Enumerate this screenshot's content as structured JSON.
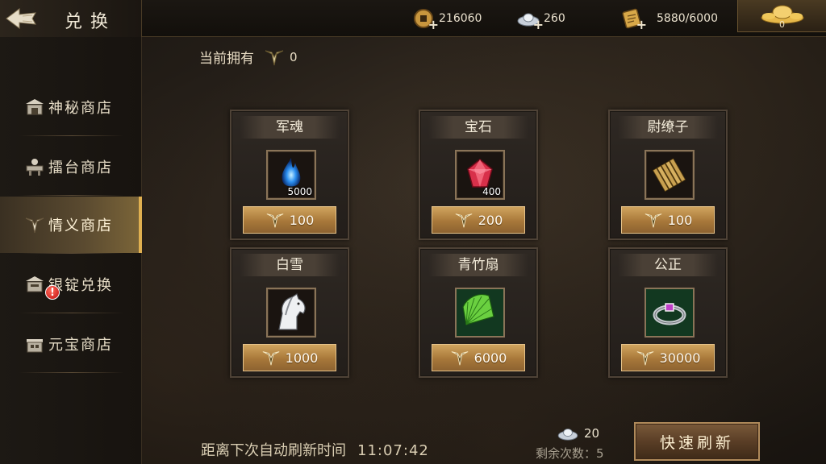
{
  "header": {
    "title": "兑换",
    "resources": [
      {
        "icon": "copper-coin-icon",
        "value": "216060"
      },
      {
        "icon": "silver-ingot-icon",
        "value": "260"
      },
      {
        "icon": "scroll-token-icon",
        "value": "5880/6000"
      }
    ],
    "gold": {
      "icon": "gold-ingot-icon",
      "value": "0"
    }
  },
  "sidebar": {
    "items": [
      {
        "label": "神秘商店",
        "icon": "mystery-shop-icon"
      },
      {
        "label": "擂台商店",
        "icon": "arena-shop-icon"
      },
      {
        "label": "情义商店",
        "icon": "loyalty-shop-icon",
        "active": true
      },
      {
        "label": "银锭兑换",
        "icon": "silver-exchange-icon"
      },
      {
        "label": "元宝商店",
        "icon": "ingot-shop-icon",
        "alert": "!"
      }
    ]
  },
  "owned": {
    "label": "当前拥有",
    "value": "0"
  },
  "items": [
    {
      "name": "军魂",
      "icon": "blue-flame-icon",
      "qty": "5000",
      "price": "100"
    },
    {
      "name": "宝石",
      "icon": "red-gem-icon",
      "qty": "400",
      "price": "200"
    },
    {
      "name": "尉缭子",
      "icon": "bamboo-scroll-icon",
      "qty": "",
      "price": "100"
    },
    {
      "name": "白雪",
      "icon": "white-horse-icon",
      "qty": "",
      "price": "1000"
    },
    {
      "name": "青竹扇",
      "icon": "green-fan-icon",
      "qty": "",
      "price": "6000"
    },
    {
      "name": "公正",
      "icon": "gem-ring-icon",
      "qty": "",
      "price": "30000"
    }
  ],
  "footer": {
    "countdown_label": "距离下次自动刷新时间",
    "countdown_time": "11:07:42",
    "refresh_cost": "20",
    "remaining_label": "剩余次数：",
    "remaining_value": "5",
    "refresh_button": "快速刷新"
  },
  "colors": {
    "accent": "#e0b050",
    "price_button": "#c0924c"
  }
}
